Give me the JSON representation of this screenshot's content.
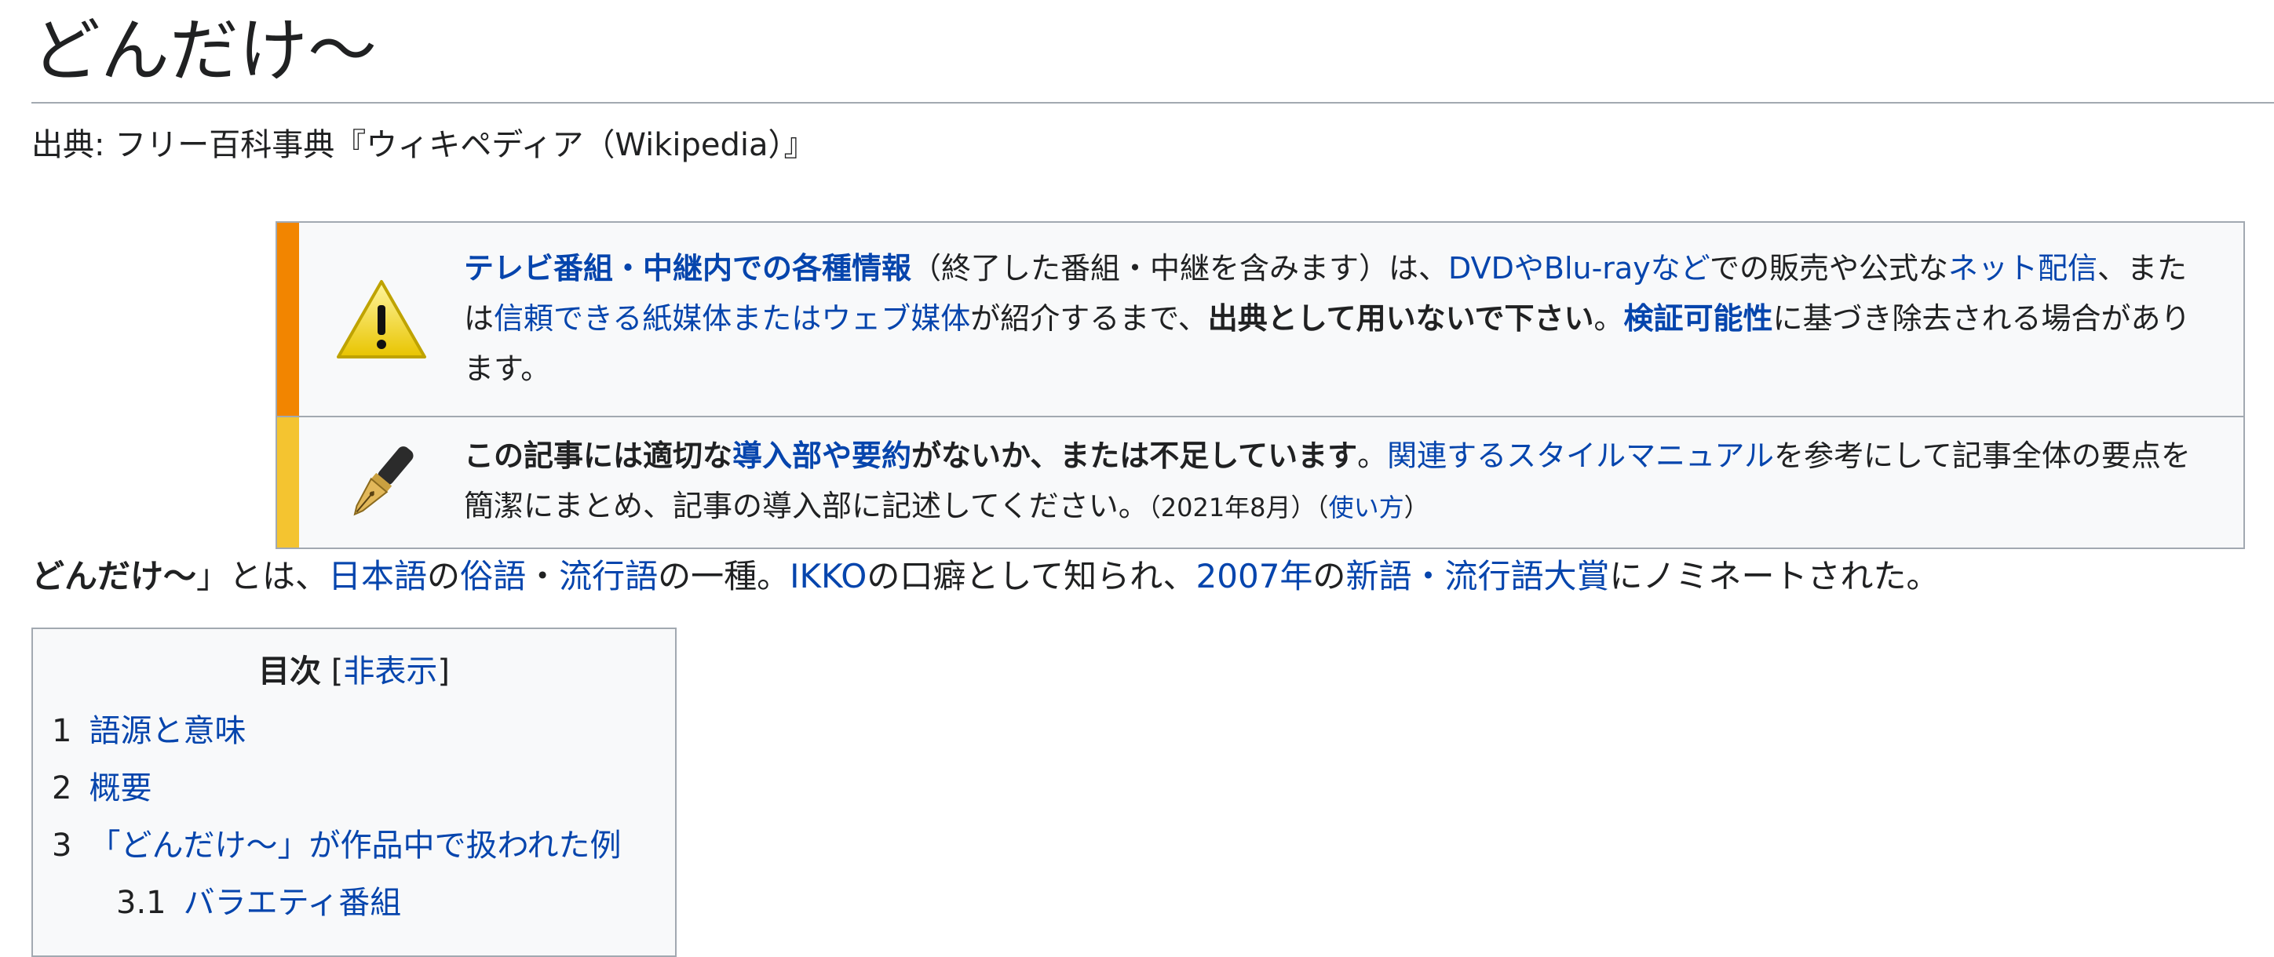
{
  "title": "どんだけ～",
  "site_sub": "出典: フリー百科事典『ウィキペディア（Wikipedia）』",
  "notice_tv": {
    "link1": "テレビ番組・中継内での各種情報",
    "t1": "（終了した番組・中継を含みます）は、",
    "link2": "DVDやBlu-rayなど",
    "t2": "での販売や公式な",
    "link3": "ネット配信",
    "t3": "、または",
    "link4": "信頼できる紙媒体またはウェブ媒体",
    "t4": "が紹介するまで、",
    "bold1": "出典として用いないで下さい",
    "t5": "。",
    "link5": "検証可能性",
    "t6": "に基づき除去される場合があります。"
  },
  "notice_lead": {
    "b1": "この記事には適切な",
    "link1": "導入部や要約",
    "b2": "がないか、または不足しています",
    "t1": "。",
    "link2": "関連するスタイルマニュアル",
    "t2": "を参考にして記事全体の要点を簡潔にまとめ、記事の導入部に記述してください。",
    "date": "（2021年8月）",
    "usage_open": "（",
    "usage_link": "使い方",
    "usage_close": "）"
  },
  "lead": {
    "bold": "どんだけ～",
    "t1": "」とは、",
    "l1": "日本語",
    "t2": "の",
    "l2": "俗語",
    "t3": "・",
    "l3": "流行語",
    "t4": "の一種。",
    "l4": "IKKO",
    "t5": "の口癖として知られ、",
    "l5": "2007年",
    "t6": "の",
    "l6": "新語・流行語大賞",
    "t7": "にノミネートされた。"
  },
  "toc": {
    "title": "目次",
    "toggle_open": "[",
    "toggle": "非表示",
    "toggle_close": "]",
    "items": [
      {
        "num": "1",
        "label": "語源と意味"
      },
      {
        "num": "2",
        "label": "概要"
      },
      {
        "num": "3",
        "label": "「どんだけ～」が作品中で扱われた例"
      },
      {
        "num": "3.1",
        "label": "バラエティ番組"
      }
    ]
  },
  "colors": {
    "link": "#0645ad",
    "notice_orange": "#f28500",
    "notice_yellow": "#f4c430",
    "border": "#a2a9b1"
  },
  "icons": {
    "notice_tv": "warning-triangle-icon",
    "notice_lead": "fountain-pen-icon"
  }
}
